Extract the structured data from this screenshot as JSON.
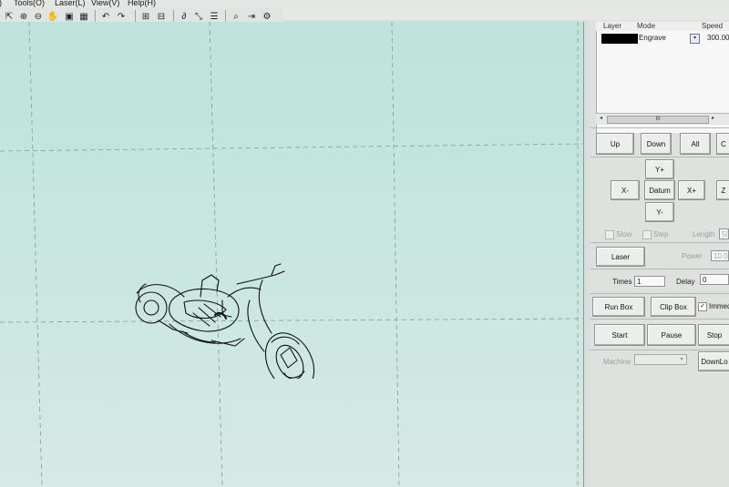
{
  "menubar": {
    "items": [
      ")",
      "Tools(O)",
      "Laser(L)",
      "View(V)",
      "Help(H)"
    ]
  },
  "toolbar": {
    "icons": [
      "select-icon",
      "zoom-in-icon",
      "zoom-out-icon",
      "pan-hand-icon",
      "view-icon",
      "page-icon",
      "undo-icon",
      "redo-icon",
      "align-icon",
      "group-icon",
      "node-edit-icon",
      "path-icon",
      "hatch-icon",
      "preview-icon",
      "output-icon",
      "settings-icon"
    ],
    "glyphs": [
      "⇱",
      "⊕",
      "⊖",
      "✋",
      "▣",
      "▦",
      "↶",
      "↷",
      "⊞",
      "⊟",
      "∂",
      "⤡",
      "☰",
      "⌕",
      "⇥",
      "⚙"
    ]
  },
  "layer_table": {
    "headers": [
      "Layer",
      "Mode",
      "Speed"
    ],
    "rows": [
      {
        "color": "#000000",
        "mode": "Engrave",
        "speed": "300.00"
      }
    ],
    "scroll_label": "III",
    "left_arrow": "◂",
    "right_arrow": "▸",
    "dropdown": "▾"
  },
  "order_buttons": {
    "up": "Up",
    "down": "Down",
    "all": "All",
    "extra": "C"
  },
  "jog": {
    "yplus": "Y+",
    "xminus": "X-",
    "datum": "Datum",
    "xplus": "X+",
    "yminus": "Y-",
    "z": "Z"
  },
  "move_options": {
    "slow": "Slow",
    "step": "Step",
    "length_label": "Length",
    "length_value": "50"
  },
  "laser": {
    "button": "Laser",
    "power_label": "Power",
    "power_value": "10.00"
  },
  "timing": {
    "times_label": "Times",
    "times_value": "1",
    "delay_label": "Delay",
    "delay_value": "0"
  },
  "box": {
    "run": "Run Box",
    "clip": "Clip Box",
    "immediate": "Immed",
    "checked": "✓"
  },
  "control": {
    "start": "Start",
    "pause": "Pause",
    "stop": "Stop"
  },
  "machine": {
    "label": "Machine",
    "value": "",
    "download": "DownLo"
  },
  "colors": {
    "canvas_top": "#bfe3dc",
    "canvas_bottom": "#d6e9e5",
    "panel": "#dfe1df"
  }
}
